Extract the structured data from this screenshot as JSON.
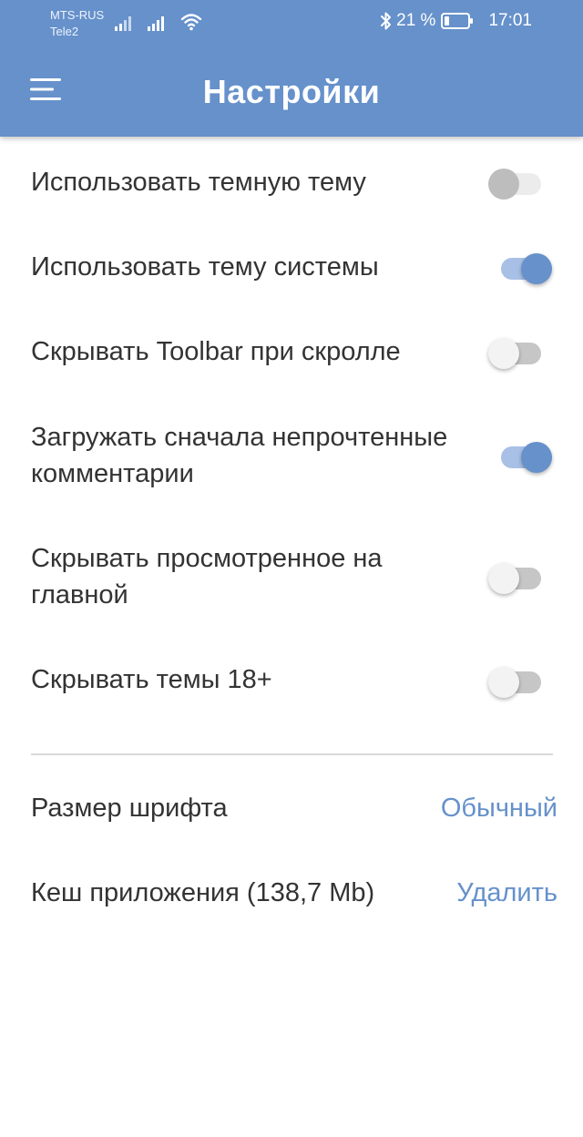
{
  "status_bar": {
    "carrier_1": "MTS-RUS",
    "carrier_2": "Tele2",
    "battery_percent": "21 %",
    "battery_level": 0.21,
    "time": "17:01"
  },
  "toolbar": {
    "title": "Настройки",
    "menu_icon": "hamburger-menu-icon"
  },
  "settings": [
    {
      "label": "Использовать темную тему",
      "enabled": false
    },
    {
      "label": "Использовать тему системы",
      "enabled": true
    },
    {
      "label": "Скрывать Toolbar при скролле",
      "enabled": false
    },
    {
      "label": "Загружать сначала непрочтенные комментарии",
      "enabled": true
    },
    {
      "label": "Скрывать просмотренное на главной",
      "enabled": false
    },
    {
      "label": "Скрывать темы 18+",
      "enabled": false
    }
  ],
  "font_size": {
    "label": "Размер шрифта",
    "value": "Обычный"
  },
  "cache": {
    "label": "Кеш приложения (138,7 Mb)",
    "action": "Удалить"
  },
  "colors": {
    "accent": "#6691cb",
    "text": "#333333",
    "background": "#ffffff"
  }
}
